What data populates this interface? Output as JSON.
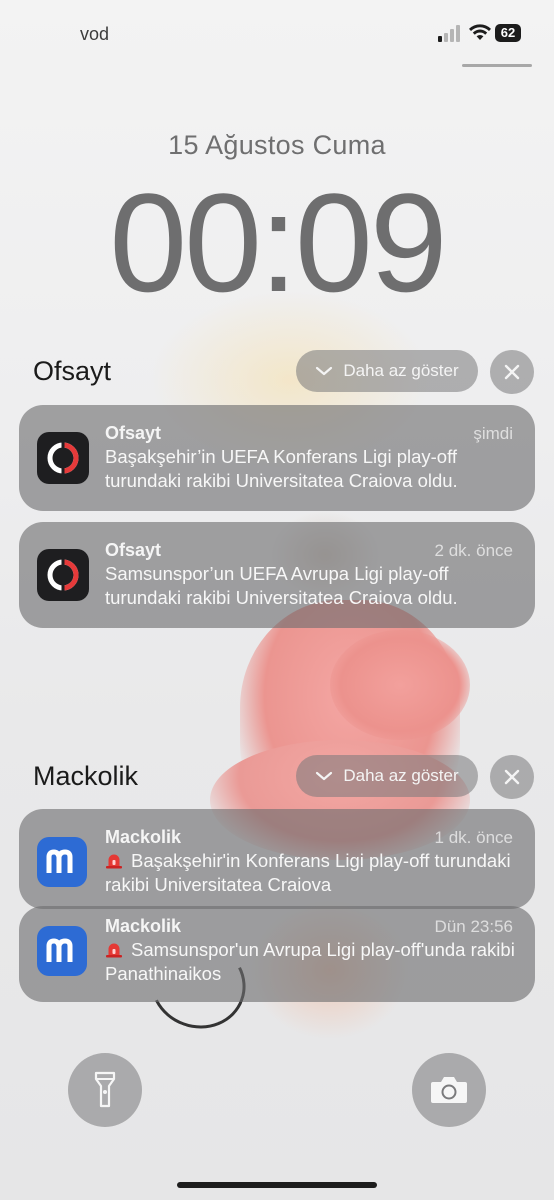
{
  "status_bar": {
    "carrier": "vod",
    "battery": "62"
  },
  "lock": {
    "date": "15 Ağustos Cuma",
    "time": "00:09"
  },
  "groups": [
    {
      "app": "Ofsayt",
      "show_less_label": "Daha az göster",
      "notifications": [
        {
          "app_name": "Ofsayt",
          "time": "şimdi",
          "body": "Başakşehir’in UEFA Konferans Ligi play-off turundaki rakibi Universitatea Craiova oldu."
        },
        {
          "app_name": "Ofsayt",
          "time": "2 dk. önce",
          "body": "Samsunspor’un UEFA Avrupa Ligi play-off turundaki rakibi Universitatea Craiova oldu."
        }
      ]
    },
    {
      "app": "Mackolik",
      "show_less_label": "Daha az göster",
      "notifications": [
        {
          "app_name": "Mackolik",
          "time": "1 dk. önce",
          "body": "Başakşehir'in Konferans Ligi play-off turundaki rakibi Universitatea Craiova"
        },
        {
          "app_name": "Mackolik",
          "time": "Dün 23:56",
          "body": "Samsunspor'un Avrupa Ligi play-off'unda rakibi Panathinaikos"
        }
      ]
    }
  ],
  "quick_actions": {
    "left": "flashlight-icon",
    "right": "camera-icon"
  },
  "colors": {
    "mackolik_brand": "#2d6bd4",
    "ofsayt_icon_bg": "#1e1e20",
    "ofsayt_accent": "#e63a3a"
  }
}
